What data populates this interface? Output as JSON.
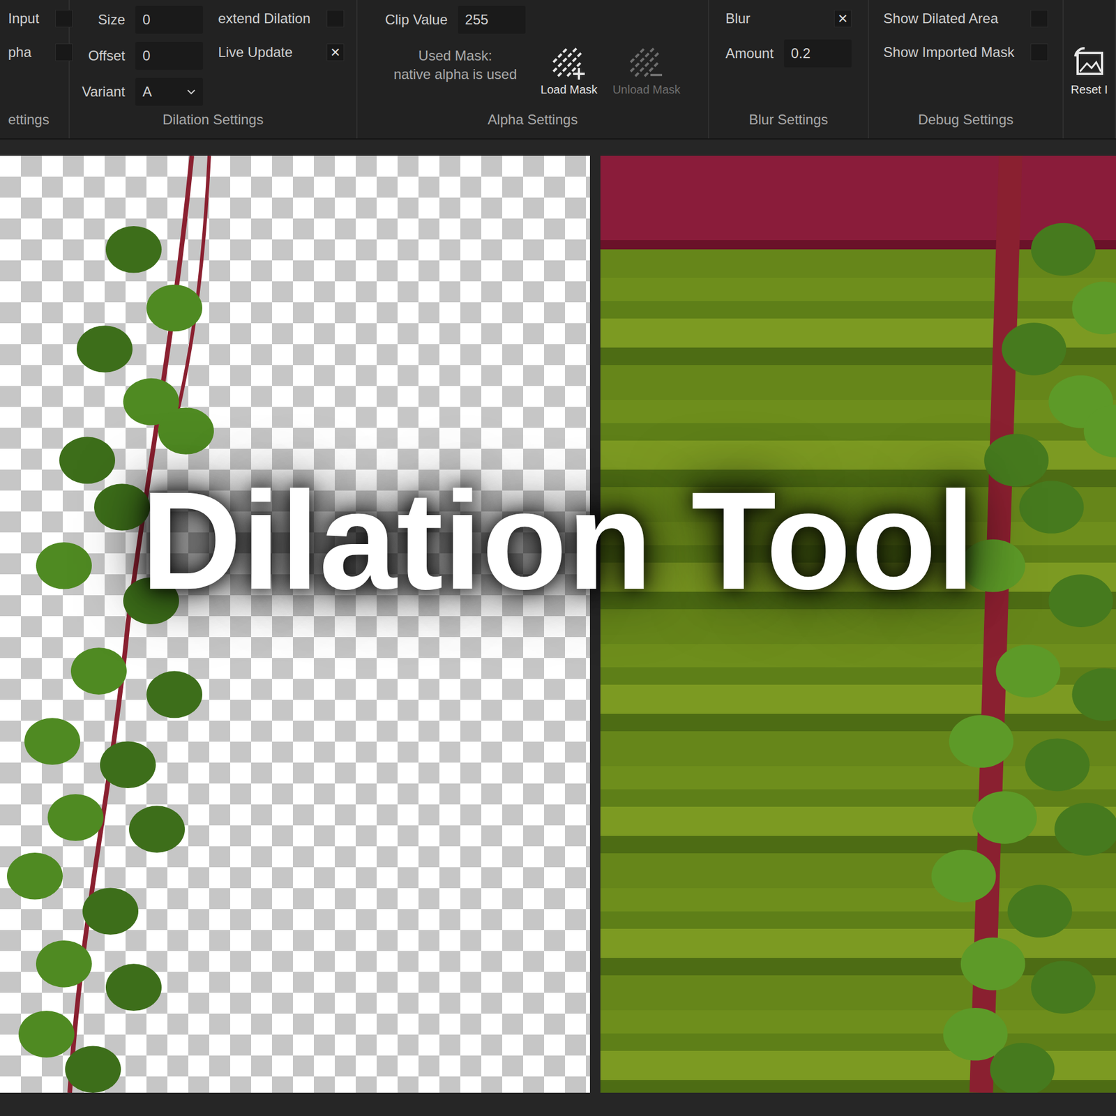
{
  "check_mark": "×",
  "toolbar_groups": [
    {
      "label": "ettings",
      "columns": [
        [
          {
            "kind": "checkbox",
            "label": "Input",
            "checked": false
          },
          {
            "kind": "checkbox",
            "label": "pha",
            "checked": false
          }
        ]
      ]
    },
    {
      "label": "Dilation Settings",
      "columns": [
        [
          {
            "kind": "field",
            "label": "Size",
            "value": "0"
          },
          {
            "kind": "field",
            "label": "Offset",
            "value": "0"
          },
          {
            "kind": "dropdown",
            "label": "Variant",
            "value": "A"
          }
        ],
        [
          {
            "kind": "checkbox",
            "label": "extend Dilation",
            "checked": false
          },
          {
            "kind": "checkbox",
            "label": "Live Update",
            "checked": true
          }
        ]
      ]
    },
    {
      "label": "Alpha Settings",
      "columns": [
        [
          {
            "kind": "field",
            "label": "Clip Value",
            "value": "255"
          },
          {
            "kind": "note",
            "lines": [
              "Used Mask:",
              "native alpha is used"
            ]
          }
        ],
        [
          {
            "kind": "button",
            "icon": "load",
            "label": "Load Mask",
            "disabled": false
          }
        ],
        [
          {
            "kind": "button",
            "icon": "unload",
            "label": "Unload Mask",
            "disabled": true
          }
        ]
      ]
    },
    {
      "label": "Blur Settings",
      "columns": [
        [
          {
            "kind": "checkbox",
            "label": "Blur",
            "checked": true
          },
          {
            "kind": "field",
            "label": "Amount",
            "value": "0.2"
          }
        ]
      ]
    },
    {
      "label": "Debug Settings",
      "columns": [
        [
          {
            "kind": "checkbox",
            "label": "Show Dilated Area",
            "checked": false
          },
          {
            "kind": "checkbox",
            "label": "Show Imported Mask",
            "checked": false
          }
        ]
      ]
    },
    {
      "label": "",
      "columns": [
        [
          {
            "kind": "button",
            "icon": "reset",
            "label": "Reset I",
            "disabled": false
          }
        ]
      ]
    }
  ],
  "title": "Dilation Tool"
}
